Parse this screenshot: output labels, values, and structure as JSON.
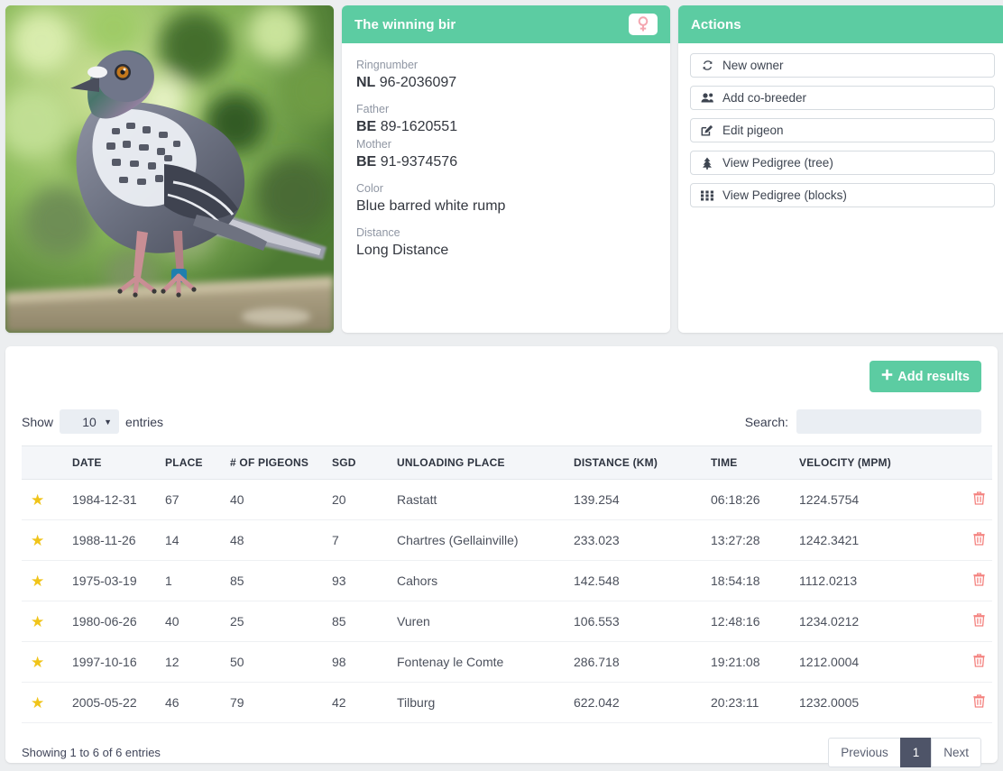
{
  "pigeon_photo": {
    "alt": "racing pigeon standing on wooden ledge",
    "icon": "pigeon-photo"
  },
  "detail_panel": {
    "title": "The winning bir",
    "sex_icon": "female-icon",
    "sex_symbol": "♀",
    "fields": [
      {
        "label": "Ringnumber",
        "country": "NL",
        "number": "96-2036097"
      },
      {
        "label": "Father",
        "country": "BE",
        "number": "89-1620551"
      },
      {
        "label": "Mother",
        "country": "BE",
        "number": "91-9374576"
      },
      {
        "label": "Color",
        "country": "",
        "number": "Blue barred white rump"
      },
      {
        "label": "Distance",
        "country": "",
        "number": "Long Distance"
      }
    ]
  },
  "actions_panel": {
    "title": "Actions",
    "buttons": [
      {
        "label": "New owner",
        "icon": "refresh-icon"
      },
      {
        "label": "Add co-breeder",
        "icon": "users-icon"
      },
      {
        "label": "Edit pigeon",
        "icon": "pencil-square-icon"
      },
      {
        "label": "View Pedigree (tree)",
        "icon": "tree-icon"
      },
      {
        "label": "View Pedigree (blocks)",
        "icon": "grid-icon"
      }
    ]
  },
  "results": {
    "add_button": {
      "label": "Add results",
      "icon": "plus-icon"
    },
    "show_label": "Show",
    "entries_label": "entries",
    "page_size": "10",
    "search_label": "Search:",
    "search_value": "",
    "search_placeholder": "",
    "columns": [
      "",
      "DATE",
      "PLACE",
      "# OF PIGEONS",
      "SGD",
      "UNLOADING PLACE",
      "DISTANCE (KM)",
      "TIME",
      "VELOCITY (MPM)",
      ""
    ],
    "rows": [
      {
        "star": "★",
        "date": "1984-12-31",
        "place": "67",
        "pigeons": "40",
        "sgd": "20",
        "unloading": "Rastatt",
        "distance": "139.254",
        "time": "06:18:26",
        "velocity": "1224.5754",
        "delete_icon": "trash-icon"
      },
      {
        "star": "★",
        "date": "1988-11-26",
        "place": "14",
        "pigeons": "48",
        "sgd": "7",
        "unloading": "Chartres (Gellainville)",
        "distance": "233.023",
        "time": "13:27:28",
        "velocity": "1242.3421",
        "delete_icon": "trash-icon"
      },
      {
        "star": "★",
        "date": "1975-03-19",
        "place": "1",
        "pigeons": "85",
        "sgd": "93",
        "unloading": "Cahors",
        "distance": "142.548",
        "time": "18:54:18",
        "velocity": "1112.0213",
        "delete_icon": "trash-icon"
      },
      {
        "star": "★",
        "date": "1980-06-26",
        "place": "40",
        "pigeons": "25",
        "sgd": "85",
        "unloading": "Vuren",
        "distance": "106.553",
        "time": "12:48:16",
        "velocity": "1234.0212",
        "delete_icon": "trash-icon"
      },
      {
        "star": "★",
        "date": "1997-10-16",
        "place": "12",
        "pigeons": "50",
        "sgd": "98",
        "unloading": "Fontenay le Comte",
        "distance": "286.718",
        "time": "19:21:08",
        "velocity": "1212.0004",
        "delete_icon": "trash-icon"
      },
      {
        "star": "★",
        "date": "2005-05-22",
        "place": "46",
        "pigeons": "79",
        "sgd": "42",
        "unloading": "Tilburg",
        "distance": "622.042",
        "time": "20:23:11",
        "velocity": "1232.0005",
        "delete_icon": "trash-icon"
      }
    ],
    "info": "Showing 1 to 6 of 6 entries",
    "pagination": {
      "previous": "Previous",
      "current": "1",
      "next": "Next"
    }
  },
  "colors": {
    "accent_green": "#5ccca2",
    "page_background": "#eceef0",
    "star_yellow": "#f0c419",
    "trash_red": "#f4827f",
    "pagination_active": "#4e5468",
    "female_pink": "#f4a6b0"
  }
}
